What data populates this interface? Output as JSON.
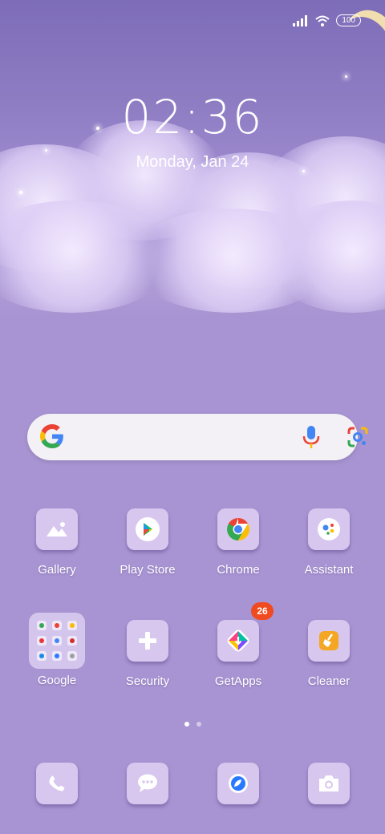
{
  "status_bar": {
    "battery": "100"
  },
  "lock": {
    "time": "02:36",
    "date": "Monday, Jan 24"
  },
  "apps_row1": [
    {
      "label": "Gallery",
      "icon": "gallery-icon"
    },
    {
      "label": "Play Store",
      "icon": "play-store-icon"
    },
    {
      "label": "Chrome",
      "icon": "chrome-icon"
    },
    {
      "label": "Assistant",
      "icon": "assistant-icon"
    }
  ],
  "apps_row2": [
    {
      "label": "Google",
      "icon": "folder-icon"
    },
    {
      "label": "Security",
      "icon": "plus-icon"
    },
    {
      "label": "GetApps",
      "icon": "getapps-icon",
      "badge": "26"
    },
    {
      "label": "Cleaner",
      "icon": "broom-icon"
    }
  ],
  "dock": [
    {
      "icon": "phone-icon"
    },
    {
      "icon": "messages-icon"
    },
    {
      "icon": "browser-icon"
    },
    {
      "icon": "camera-icon"
    }
  ],
  "colors": {
    "accent": "#a894d2",
    "badge": "#f04a20"
  }
}
